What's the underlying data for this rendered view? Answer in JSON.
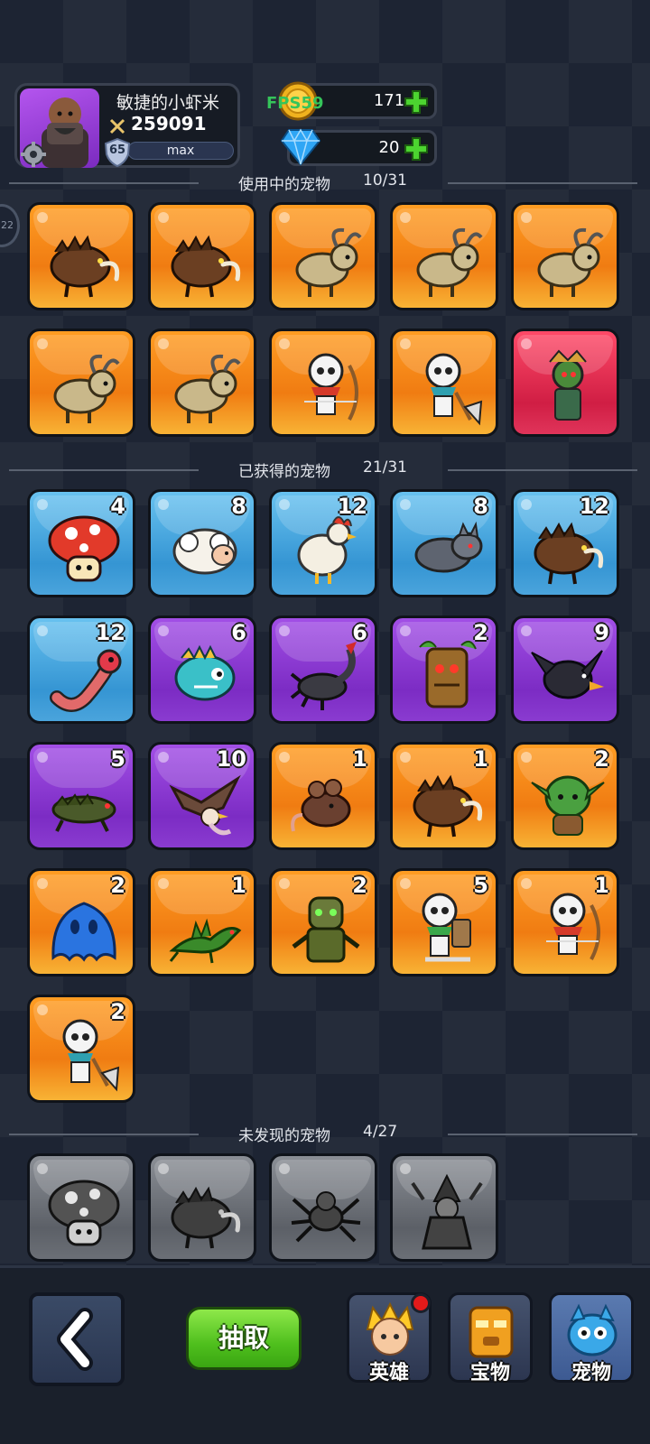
{
  "header": {
    "player_name": "敏捷的小虾米",
    "power": "259091",
    "level": "65",
    "xp_label": "max",
    "gold": "171",
    "gems": "20",
    "fps_overlay": "FPS59"
  },
  "side_chip": "22",
  "sections": {
    "in_use": {
      "title": "使用中的宠物",
      "count": "10/31"
    },
    "obtained": {
      "title": "已获得的宠物",
      "count": "21/31"
    },
    "undiscovered": {
      "title": "未发现的宠物",
      "count": "4/27"
    }
  },
  "in_use_pets": [
    {
      "icon": "boar-icon",
      "rarity": "orange"
    },
    {
      "icon": "boar-icon",
      "rarity": "orange"
    },
    {
      "icon": "goat-icon",
      "rarity": "orange"
    },
    {
      "icon": "goat-icon",
      "rarity": "orange"
    },
    {
      "icon": "goat-icon",
      "rarity": "orange"
    },
    {
      "icon": "goat-icon",
      "rarity": "orange"
    },
    {
      "icon": "goat-icon",
      "rarity": "orange"
    },
    {
      "icon": "skeleton-archer-icon",
      "rarity": "orange"
    },
    {
      "icon": "skeleton-axe-icon",
      "rarity": "orange"
    },
    {
      "icon": "shaman-icon",
      "rarity": "red"
    }
  ],
  "obtained_pets": [
    {
      "icon": "mushroom-icon",
      "rarity": "blue",
      "qty": "4"
    },
    {
      "icon": "sheep-icon",
      "rarity": "blue",
      "qty": "8"
    },
    {
      "icon": "rooster-icon",
      "rarity": "blue",
      "qty": "12"
    },
    {
      "icon": "wolf-icon",
      "rarity": "blue",
      "qty": "8"
    },
    {
      "icon": "boar-icon",
      "rarity": "blue",
      "qty": "12"
    },
    {
      "icon": "worm-icon",
      "rarity": "blue",
      "qty": "12"
    },
    {
      "icon": "fish-icon",
      "rarity": "purple",
      "qty": "6"
    },
    {
      "icon": "scorpion-icon",
      "rarity": "purple",
      "qty": "6"
    },
    {
      "icon": "treant-icon",
      "rarity": "purple",
      "qty": "2"
    },
    {
      "icon": "crow-icon",
      "rarity": "purple",
      "qty": "9"
    },
    {
      "icon": "lizard-icon",
      "rarity": "purple",
      "qty": "5"
    },
    {
      "icon": "vulture-icon",
      "rarity": "purple",
      "qty": "10"
    },
    {
      "icon": "rat-icon",
      "rarity": "orange",
      "qty": "1"
    },
    {
      "icon": "boar-icon",
      "rarity": "orange",
      "qty": "1"
    },
    {
      "icon": "goblin-icon",
      "rarity": "orange",
      "qty": "2"
    },
    {
      "icon": "slime-icon",
      "rarity": "orange",
      "qty": "2"
    },
    {
      "icon": "dragon-icon",
      "rarity": "orange",
      "qty": "1"
    },
    {
      "icon": "zombie-icon",
      "rarity": "orange",
      "qty": "2"
    },
    {
      "icon": "skeleton-sword-icon",
      "rarity": "orange",
      "qty": "5"
    },
    {
      "icon": "skeleton-archer-icon",
      "rarity": "orange",
      "qty": "1"
    },
    {
      "icon": "skeleton-axe-icon",
      "rarity": "orange",
      "qty": "2"
    }
  ],
  "undiscovered_pets": [
    {
      "icon": "mushroom-icon",
      "rarity": "gray"
    },
    {
      "icon": "boar-icon",
      "rarity": "gray"
    },
    {
      "icon": "spider-icon",
      "rarity": "gray"
    },
    {
      "icon": "witch-icon",
      "rarity": "gray"
    }
  ],
  "bottom_nav": {
    "draw_label": "抽取",
    "tabs": [
      {
        "label": "英雄",
        "icon": "hero-icon",
        "has_badge": true
      },
      {
        "label": "宝物",
        "icon": "treasure-icon",
        "has_badge": false
      },
      {
        "label": "宠物",
        "icon": "pet-icon",
        "has_badge": false
      }
    ]
  }
}
